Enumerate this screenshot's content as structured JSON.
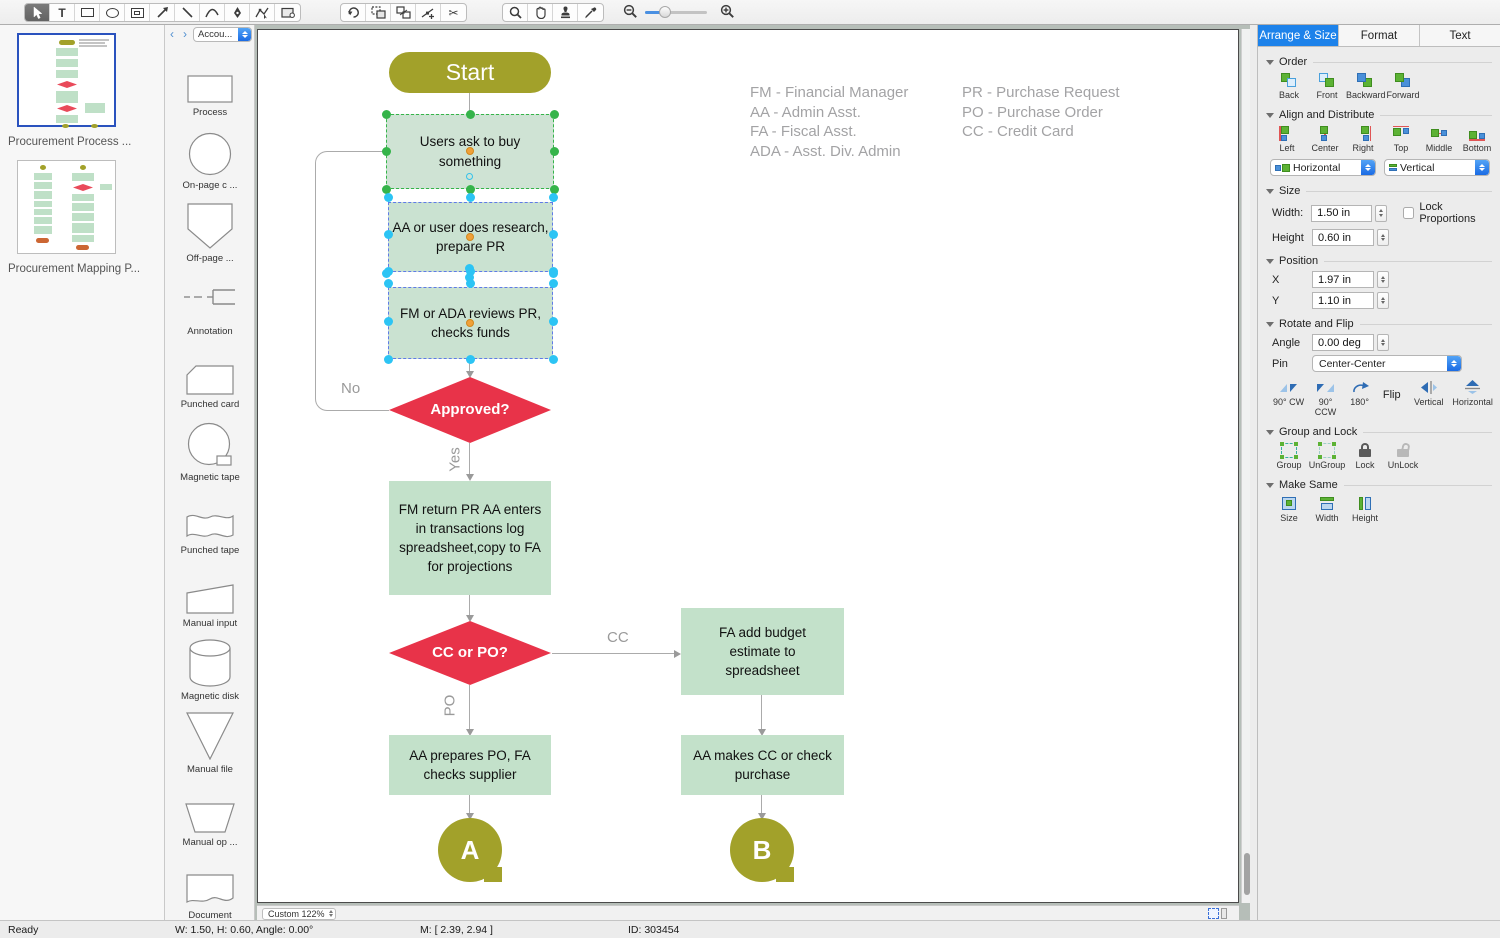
{
  "toolbar": {
    "draw_tools": [
      "pointer",
      "text",
      "rectangle",
      "ellipse",
      "frame",
      "arrow",
      "line",
      "curve",
      "pen",
      "reshape",
      "shape-data"
    ],
    "edit_tools": [
      "rotate",
      "group",
      "ungroup",
      "add-anchor",
      "cut"
    ],
    "view_tools": [
      "zoom-area",
      "pan-hand",
      "stamp",
      "eyedropper"
    ],
    "text_tool_glyph": "T"
  },
  "pages_panel": {
    "pages": [
      {
        "label": "Procurement Process ...",
        "selected": true
      },
      {
        "label": "Procurement Mapping P...",
        "selected": false
      }
    ]
  },
  "shapes_panel": {
    "library_select": "Accou...",
    "shapes": [
      {
        "label": "Process"
      },
      {
        "label": "On-page c ..."
      },
      {
        "label": "Off-page  ..."
      },
      {
        "label": "Annotation"
      },
      {
        "label": "Punched card"
      },
      {
        "label": "Magnetic tape"
      },
      {
        "label": "Punched tape"
      },
      {
        "label": "Manual input"
      },
      {
        "label": "Magnetic disk"
      },
      {
        "label": "Manual file"
      },
      {
        "label": "Manual op ..."
      },
      {
        "label": "Document"
      }
    ]
  },
  "canvas": {
    "zoom_control": "Custom 122%",
    "flowchart": {
      "start": "Start",
      "box_users": "Users ask to buy something",
      "box_research": "AA or user does research, prepare PR",
      "box_reviews": "FM or ADA reviews PR, checks funds",
      "decision_approved": "Approved?",
      "label_no": "No",
      "label_yes": "Yes",
      "box_return": "FM return PR AA enters in transactions log spreadsheet,copy to FA for projections",
      "decision_ccpo": "CC or PO?",
      "label_cc": "CC",
      "label_po": "PO",
      "box_budget": "FA add budget estimate to spreadsheet",
      "box_po": "AA prepares PO, FA checks supplier",
      "box_cc": "AA makes CC or check purchase",
      "connector_a": "A",
      "connector_b": "B"
    },
    "legend": {
      "col1": [
        "FM - Financial Manager",
        "AA - Admin Asst.",
        "FA - Fiscal Asst.",
        "ADA - Asst. Div. Admin"
      ],
      "col2": [
        "PR - Purchase Request",
        "PO - Purchase Order",
        "CC - Credit Card"
      ]
    },
    "colors": {
      "terminator_olive": "#a2a12a",
      "process_green": "#c3e1ca",
      "decision_red": "#e83349",
      "connector_gray": "#ababab",
      "selection_green": "#35b44a",
      "selection_cyan": "#2cc4f4"
    }
  },
  "right_panel": {
    "tabs": [
      {
        "label": "Arrange & Size",
        "active": true
      },
      {
        "label": "Format",
        "active": false
      },
      {
        "label": "Text",
        "active": false
      }
    ],
    "order": {
      "title": "Order",
      "back": "Back",
      "front": "Front",
      "backward": "Backward",
      "forward": "Forward"
    },
    "align": {
      "title": "Align and Distribute",
      "left": "Left",
      "center": "Center",
      "right": "Right",
      "top": "Top",
      "middle": "Middle",
      "bottom": "Bottom",
      "dropdown_horizontal": "Horizontal",
      "dropdown_vertical": "Vertical"
    },
    "size": {
      "title": "Size",
      "width_label": "Width:",
      "width_value": "1.50 in",
      "height_label": "Height",
      "height_value": "0.60 in",
      "lock_label": "Lock Proportions"
    },
    "position": {
      "title": "Position",
      "x_label": "X",
      "x_value": "1.97 in",
      "y_label": "Y",
      "y_value": "1.10 in"
    },
    "rotate": {
      "title": "Rotate and Flip",
      "angle_label": "Angle",
      "angle_value": "0.00 deg",
      "pin_label": "Pin",
      "pin_value": "Center-Center",
      "cw": "90° CW",
      "ccw": "90° CCW",
      "b180": "180°",
      "flip": "Flip",
      "vertical": "Vertical",
      "horizontal": "Horizontal"
    },
    "group": {
      "title": "Group and Lock",
      "group": "Group",
      "ungroup": "UnGroup",
      "lock": "Lock",
      "unlock": "UnLock"
    },
    "make_same": {
      "title": "Make Same",
      "size": "Size",
      "width": "Width",
      "height": "Height"
    }
  },
  "status_bar": {
    "ready": "Ready",
    "dimensions": "W: 1.50,  H: 0.60,  Angle: 0.00°",
    "mouse": "M: [ 2.39, 2.94 ]",
    "id": "ID: 303454"
  }
}
